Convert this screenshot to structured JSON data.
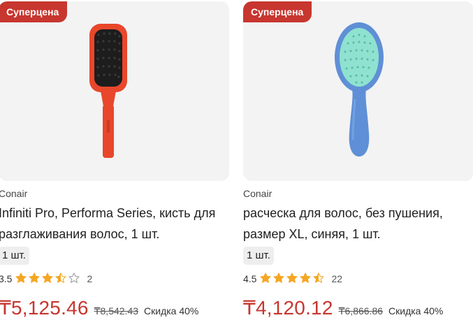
{
  "colors": {
    "accent_red": "#c7362f",
    "card_bg": "#f3f3f4",
    "star_fill": "#f5a623"
  },
  "products": [
    {
      "badge": "Суперцена",
      "brand": "Conair",
      "title": "Infiniti Pro, Performa Series, кисть для разглаживания волос, 1 шт.",
      "quantity": "1 шт.",
      "rating": "3.5",
      "rating_value": 3.5,
      "reviews": "2",
      "price": "₸5,125.46",
      "old_price": "₸8,542.43",
      "discount": "Скидка 40%",
      "image_icon": "paddle-hairbrush-icon"
    },
    {
      "badge": "Суперцена",
      "brand": "Conair",
      "title": "расческа для волос, без пушения, размер XL, синяя, 1 шт.",
      "quantity": "1 шт.",
      "rating": "4.5",
      "rating_value": 4.5,
      "reviews": "22",
      "price": "₸4,120.12",
      "old_price": "₸6,866.86",
      "discount": "Скидка 40%",
      "image_icon": "detangling-hairbrush-icon"
    }
  ]
}
